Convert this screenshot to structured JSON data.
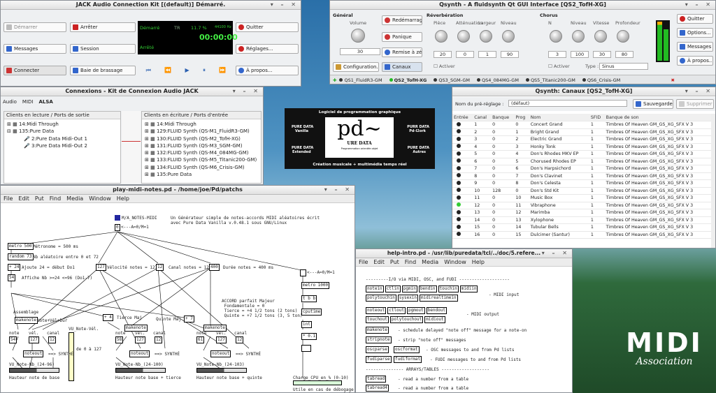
{
  "jack": {
    "title": "JACK Audio Connection Kit [(default)] Démarré.",
    "start": "Démarrer",
    "stop": "Arrêter",
    "quit": "Quitter",
    "messages": "Messages",
    "session": "Session",
    "settings": "Réglages...",
    "connect": "Connecter",
    "patchbay": "Baie de brassage",
    "about": "À propos...",
    "status_started": "Démarré",
    "status_tr": "TR",
    "status_load": "11.7 %",
    "status_rate": "44100 Hz",
    "status_time": "00:00:00",
    "status_stop": "Arrêté"
  },
  "qsynth": {
    "title": "Qsynth - A fluidsynth Qt GUI Interface [QS2_TofH-XG]",
    "general": "Général",
    "volume": "Volume",
    "volume_val": "30",
    "restart": "Redémarrage",
    "panic": "Panique",
    "reset": "Remise à zéro",
    "config": "Configuration...",
    "channels": "Canaux",
    "reverb": "Réverbération",
    "reverb_labels": [
      "Pièce",
      "Atténuation",
      "Largeur",
      "Niveau"
    ],
    "reverb_vals": [
      "20",
      "0",
      "1",
      "90"
    ],
    "chorus": "Chorus",
    "chorus_labels": [
      "N",
      "Niveau",
      "Vitesse",
      "Profondeur"
    ],
    "chorus_vals": [
      "3",
      "100",
      "30",
      "80"
    ],
    "activate": "Activer",
    "type_label": "Type :",
    "type_val": "Sinus",
    "quit": "Quitter",
    "options": "Options...",
    "messages": "Messages",
    "about": "À propos...",
    "tabs": [
      "QS1_FluidR3-GM",
      "QS2_TofH-XG",
      "QS3_SGM-GM",
      "QS4_084MG-GM",
      "QS5_Titanic200-GM",
      "QS6_Crisis-GM"
    ]
  },
  "connexions": {
    "title": "Connexions - Kit de Connexion Audio JACK",
    "tabs": [
      "Audio",
      "MIDI",
      "ALSA"
    ],
    "left_header": "Clients en lecture / Ports de sortie",
    "right_header": "Clients en écriture / Ports d'entrée",
    "left_items": [
      "14:Midi Through",
      "135:Pure Data",
      "2:Pure Data Midi-Out 1",
      "3:Pure Data Midi-Out 2"
    ],
    "right_items": [
      "14:Midi Through",
      "129:FLUID Synth (QS-M1_FluidR3-GM)",
      "130:FLUID Synth (QS-M2_TofH-XG)",
      "131:FLUID Synth (QS-M3_SGM-GM)",
      "132:FLUID Synth (QS-M4_084MG-GM)",
      "133:FLUID Synth (QS-M5_Titanic200-GM)",
      "134:FLUID Synth (QS-M6_Crisis-GM)",
      "135:Pure Data"
    ]
  },
  "pdlogo": {
    "top": "Logiciel de programmation graphique",
    "tl1": "PURE DATA",
    "tl2": "Vanilla",
    "tr1": "PURR DATA",
    "tr2": "Pd-l2ork",
    "bl1": "PURE DATA",
    "bl2": "Extended",
    "br1": "PURE DATA",
    "br2": "Autres",
    "logo_main": "pd~",
    "logo_sub": "URE  DATA",
    "tiny": "Programmation orientée objet",
    "bottom": "Création musicale + multimédia temps réel"
  },
  "canaux": {
    "title": "Qsynth: Canaux [QS2_TofH-XG]",
    "preset_label": "Nom du pré-réglage :",
    "preset_val": "(défaut)",
    "save": "Sauvegarder",
    "delete": "Supprimer",
    "headers": [
      "Entrée",
      "Canal",
      "Banque",
      "Prog",
      "Nom",
      "SFID",
      "Banque de son"
    ],
    "rows": [
      [
        "1",
        "0",
        "0",
        "Concert Grand",
        "1",
        "Timbres Of Heaven GM_GS_XG_SFX V 3"
      ],
      [
        "2",
        "0",
        "1",
        "Bright Grand",
        "1",
        "Timbres Of Heaven GM_GS_XG_SFX V 3"
      ],
      [
        "3",
        "0",
        "2",
        "Electric Grand",
        "1",
        "Timbres Of Heaven GM_GS_XG_SFX V 3"
      ],
      [
        "4",
        "0",
        "3",
        "Honky Tonk",
        "1",
        "Timbres Of Heaven GM_GS_XG_SFX V 3"
      ],
      [
        "5",
        "0",
        "4",
        "Don's Rhodes MKV EP",
        "1",
        "Timbres Of Heaven GM_GS_XG_SFX V 3"
      ],
      [
        "6",
        "0",
        "5",
        "Chorused Rhodes EP",
        "1",
        "Timbres Of Heaven GM_GS_XG_SFX V 3"
      ],
      [
        "7",
        "0",
        "6",
        "Don's Harpsichord",
        "1",
        "Timbres Of Heaven GM_GS_XG_SFX V 3"
      ],
      [
        "8",
        "0",
        "7",
        "Don's Clavinet",
        "1",
        "Timbres Of Heaven GM_GS_XG_SFX V 3"
      ],
      [
        "9",
        "0",
        "8",
        "Don's Celesta",
        "1",
        "Timbres Of Heaven GM_GS_XG_SFX V 3"
      ],
      [
        "10",
        "128",
        "0",
        "Don's Std Kit",
        "1",
        "Timbres Of Heaven GM_GS_XG_SFX V 3"
      ],
      [
        "11",
        "0",
        "10",
        "Music Box",
        "1",
        "Timbres Of Heaven GM_GS_XG_SFX V 3"
      ],
      [
        "12",
        "0",
        "11",
        "Vibraphone",
        "1",
        "Timbres Of Heaven GM_GS_XG_SFX V 3"
      ],
      [
        "13",
        "0",
        "12",
        "Marimba",
        "1",
        "Timbres Of Heaven GM_GS_XG_SFX V 3"
      ],
      [
        "14",
        "0",
        "13",
        "Xylophone",
        "1",
        "Timbres Of Heaven GM_GS_XG_SFX V 3"
      ],
      [
        "15",
        "0",
        "14",
        "Tubular Bells",
        "1",
        "Timbres Of Heaven GM_GS_XG_SFX V 3"
      ],
      [
        "16",
        "0",
        "15",
        "Dulcimer (Santur)",
        "1",
        "Timbres Of Heaven GM_GS_XG_SFX V 3"
      ]
    ],
    "active_row": 12
  },
  "pdwin": {
    "title": "play-midi-notes.pd  - /home/joe/Pd/patchs",
    "menu": [
      "File",
      "Edit",
      "Put",
      "Find",
      "Media",
      "Window",
      "Help"
    ],
    "a_notes": "M/A_NOTES-MIDI",
    "intro": "Un Générateur simple de notes-accords MIDI aléatoires écrit\navec Pure Data Vanilla v.0.48.1 sous GNU/Linux",
    "o_0": "0",
    "c_a0": "<---A=0/M=1",
    "o_metro": "metro 500",
    "c_metro": "Métronome = 500 ms",
    "o_random": "random 73",
    "c_random": "Nb aléatoire entre 0 et 72",
    "o_plus24": "+ 24",
    "c_plus24": "Ajoute 24 = début Do1",
    "n_54": "54",
    "c_affiche": "Affiche Nb >=24 <=96 (Do1-7)",
    "n_127": "127",
    "c_vel": "Vélocité notes = 127",
    "n_12": "12",
    "c_canal": "Canal notes = 12",
    "n_400": "400",
    "c_dur": "Durée notes = 400 ms",
    "c_accord": "ACCORD parfait Majeur\n Fondamentale = 0\n Tierce = +4 1/2 tons (2 tons)\n Quinte = +7 1/2 tons (3, 5 ton)",
    "c_assemblage": "Assemblage",
    "o_makenote": "makenote",
    "c_notevel": "Note+Vél+Dur",
    "c_vunote": "VU_Note-Vél.",
    "c_range": "de 0 à 127",
    "o_plus4": "+ 4",
    "c_tierce": "Tierce Maj",
    "c_quinte": "Quinte Maj",
    "o_plus7": "+ 7",
    "c_note": "note",
    "c_vel2": "vél.",
    "c_canal2": "canal",
    "n_54b": "54",
    "n_58": "58",
    "n_61": "61",
    "n_127b": "127",
    "n_12b": "12",
    "o_noteout": "noteout",
    "c_synthe": "==> SYNTHÉ",
    "vu1": "VU_Note-Nb_(24-96)",
    "vu2": "VU_Note-Nb_(24-100)",
    "vu3": "VU_Note-Nb_(24-103)",
    "h1": "Hauteur note de base",
    "h2": "Hauteur note base + tierce",
    "h3": "Hauteur note base + quinte",
    "c_a0b": "<---A=0/M=1",
    "o_metro1000": "metro 1000",
    "o_bb": "t b b",
    "o_cputime": "cputime",
    "o_int": "int",
    "o_x01": "* 0.1",
    "c_cpu": "Charge_CPU_en_% (0-10)",
    "c_util": "Utile en cas de débogage"
  },
  "help": {
    "title": "help-intro.pd  - /usr/lib/puredata/tcl/../doc/5.refere...",
    "menu": [
      "File",
      "Edit",
      "Put",
      "Find",
      "Media",
      "Window",
      "Help"
    ],
    "heading": "---------I/O via MIDI, OSC, and FUDI --------------------",
    "row1": [
      "notein",
      "ctlin",
      "pgmin",
      "bendin",
      "touchin",
      "midiin"
    ],
    "row1b": [
      "polytouchin",
      "sysexin",
      "midirealtimein"
    ],
    "d1": "- MIDI input",
    "row2": [
      "noteout",
      "ctlout",
      "pgmout",
      "bendout"
    ],
    "row2b": [
      "touchout",
      "polytouchout",
      "midiout"
    ],
    "d2": "- MIDI output",
    "makenote": "makenote",
    "d3": "- schedule delayed \"note off\" message for a note-on",
    "stripnote": "stripnote",
    "d4": "- strip \"note off\" messages",
    "oscparse": "oscparse",
    "oscformat": "oscformat",
    "d5": "- OSC messages to and from Pd lists",
    "fudiparse": "fudiparse",
    "fudiformat": "fudiformat",
    "d6": "- FUDI messages to and from Pd lists",
    "heading2": "--------------- ARRAYS/TABLES -------------------",
    "tabread": "tabread",
    "d7": "- read a number from a table",
    "tabread4": "tabread4",
    "d8": "- read a number from a table"
  },
  "midi_logo": {
    "text": "MIDI",
    "sub": "Association"
  }
}
